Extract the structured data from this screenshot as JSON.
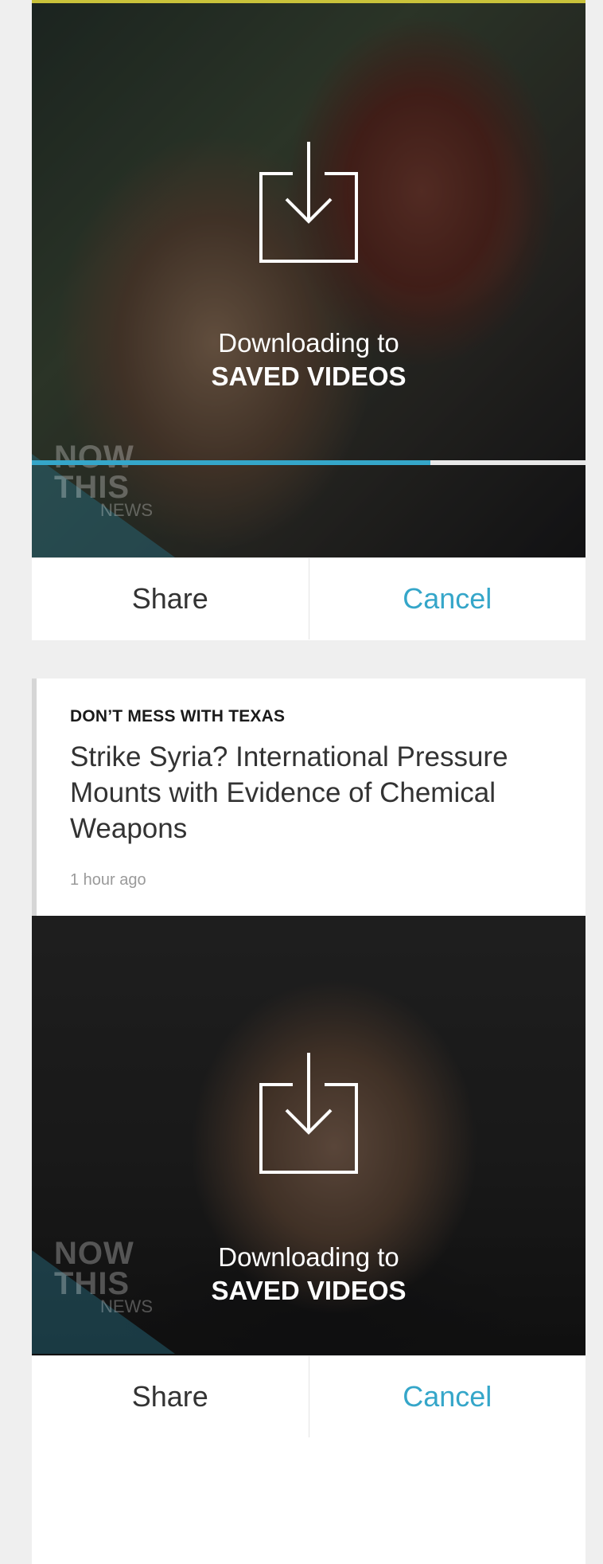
{
  "cards": [
    {
      "download_line1": "Downloading to",
      "download_line2": "SAVED VIDEOS",
      "progress": 0.72,
      "watermark": [
        "NOW",
        "THIS",
        "NEWS"
      ],
      "share_label": "Share",
      "cancel_label": "Cancel"
    },
    {
      "kicker": "DON’T MESS WITH TEXAS",
      "headline": "Strike Syria? International Pressure Mounts with Evidence of Chemical Weapons",
      "timestamp": "1 hour ago",
      "download_line1": "Downloading to",
      "download_line2": "SAVED VIDEOS",
      "progress": 0.24,
      "watermark": [
        "NOW",
        "THIS",
        "NEWS"
      ],
      "share_label": "Share",
      "cancel_label": "Cancel"
    }
  ],
  "colors": {
    "accent": "#35a6c9",
    "background": "#efefef",
    "card": "#ffffff"
  },
  "icons": {
    "download": "download-to-box-icon"
  }
}
